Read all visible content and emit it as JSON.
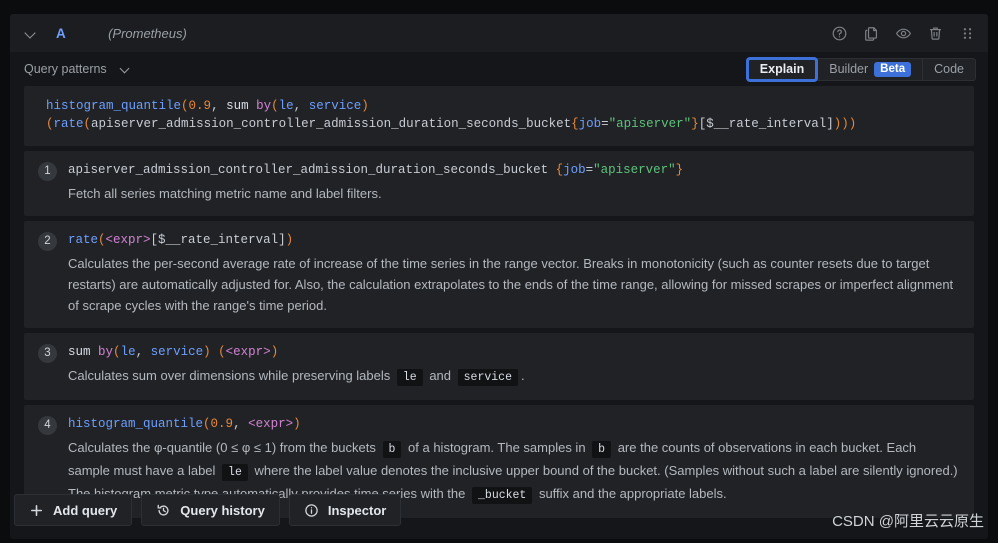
{
  "header": {
    "ref_id": "A",
    "datasource": "(Prometheus)",
    "icons": [
      {
        "name": "help-icon",
        "glyph": "question-circle"
      },
      {
        "name": "duplicate-query-icon",
        "glyph": "copy"
      },
      {
        "name": "toggle-visibility-icon",
        "glyph": "eye"
      },
      {
        "name": "remove-query-icon",
        "glyph": "trash"
      },
      {
        "name": "drag-handle-icon",
        "glyph": "grip-dots"
      }
    ]
  },
  "toolbar": {
    "query_patterns_label": "Query patterns",
    "modes": [
      {
        "label": "Explain",
        "active": true
      },
      {
        "label": "Builder",
        "badge": "Beta",
        "active": false
      },
      {
        "label": "Code",
        "active": false
      }
    ]
  },
  "query": {
    "line1": {
      "fn": "histogram_quantile",
      "open": "(",
      "num": "0.9",
      "comma": ",",
      "sum": "sum",
      "by": "by",
      "by_open": "(",
      "label1": "le",
      "label_comma": ",",
      "label2": "service",
      "by_close": ")"
    },
    "line2": {
      "open_paren": "(",
      "rate": "rate",
      "rate_open": "(",
      "metric": "apiserver_admission_controller_admission_duration_seconds_bucket",
      "brace_open": "{",
      "label": "job",
      "equals": "=",
      "value": "\"apiserver\"",
      "brace_close": "}",
      "range": "[$__rate_interval]",
      "close": ")))"
    }
  },
  "steps": [
    {
      "number": "1",
      "head": {
        "metric": "apiserver_admission_controller_admission_duration_seconds_bucket",
        "brace_open": "{",
        "label": "job",
        "equals": "=",
        "value": "\"apiserver\"",
        "brace_close": "}"
      },
      "description": "Fetch all series matching metric name and label filters."
    },
    {
      "number": "2",
      "head": {
        "fn": "rate",
        "open": "(",
        "expr": "<expr>",
        "range": "[$__rate_interval]",
        "close": ")"
      },
      "description": "Calculates the per-second average rate of increase of the time series in the range vector. Breaks in monotonicity (such as counter resets due to target restarts) are automatically adjusted for. Also, the calculation extrapolates to the ends of the time range, allowing for missed scrapes or imperfect alignment of scrape cycles with the range's time period."
    },
    {
      "number": "3",
      "head": {
        "sum": "sum",
        "by": "by",
        "open": "(",
        "label1": "le",
        "comma": ",",
        "label2": "service",
        "close": ")",
        "expr_open": "(",
        "expr": "<expr>",
        "expr_close": ")"
      },
      "desc_part1": "Calculates sum over dimensions while preserving labels",
      "chip1": "le",
      "desc_part2": "and",
      "chip2": "service",
      "desc_part3": "."
    },
    {
      "number": "4",
      "head": {
        "fn": "histogram_quantile",
        "open": "(",
        "num": "0.9",
        "comma": ",",
        "expr": "<expr>",
        "close": ")"
      },
      "desc_part1": "Calculates the φ-quantile (0 ≤ φ ≤ 1) from the buckets",
      "chip1": "b",
      "desc_part2": "of a histogram. The samples in",
      "chip2": "b",
      "desc_part3": "are the counts of observations in each bucket. Each sample must have a label",
      "chip3": "le",
      "desc_part4": "where the label value denotes the inclusive upper bound of the bucket. (Samples without such a label are silently ignored.) The histogram metric type automatically provides time series with the",
      "chip4": "_bucket",
      "desc_part5": "suffix and the appropriate labels."
    }
  ],
  "actions": [
    {
      "label": "Add query",
      "icon": "plus-icon"
    },
    {
      "label": "Query history",
      "icon": "history-icon"
    },
    {
      "label": "Inspector",
      "icon": "info-circle-icon"
    }
  ],
  "watermark": "CSDN @阿里云云原生",
  "colors": {
    "accent": "#3d71d9",
    "ref_id": "#6e9fff",
    "panel_bg": "#141619",
    "card_bg": "#202226",
    "page_bg": "#0b0c0e",
    "string": "#5ec27a",
    "keyword": "#d383d3",
    "number": "#e8883a"
  }
}
